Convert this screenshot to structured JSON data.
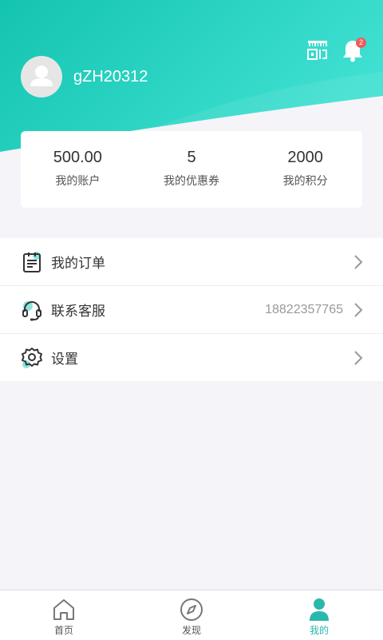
{
  "header": {
    "username": "gZH20312",
    "notification_count": "2",
    "colors": {
      "gradient_start": "#13c4b0",
      "gradient_end": "#3fe0d1"
    }
  },
  "stats": [
    {
      "value": "500.00",
      "label": "我的账户"
    },
    {
      "value": "5",
      "label": "我的优惠券"
    },
    {
      "value": "2000",
      "label": "我的积分"
    }
  ],
  "menu": {
    "items": [
      {
        "label": "我的订单",
        "icon": "order-list-icon",
        "value": ""
      },
      {
        "label": "联系客服",
        "icon": "headset-icon",
        "value": "18822357765"
      },
      {
        "label": "设置",
        "icon": "gear-icon",
        "value": ""
      }
    ]
  },
  "tabbar": {
    "items": [
      {
        "label": "首页",
        "icon": "home-icon",
        "active": false
      },
      {
        "label": "发现",
        "icon": "compass-icon",
        "active": false
      },
      {
        "label": "我的",
        "icon": "person-icon",
        "active": true
      }
    ],
    "active_color": "#2bb8ac"
  }
}
